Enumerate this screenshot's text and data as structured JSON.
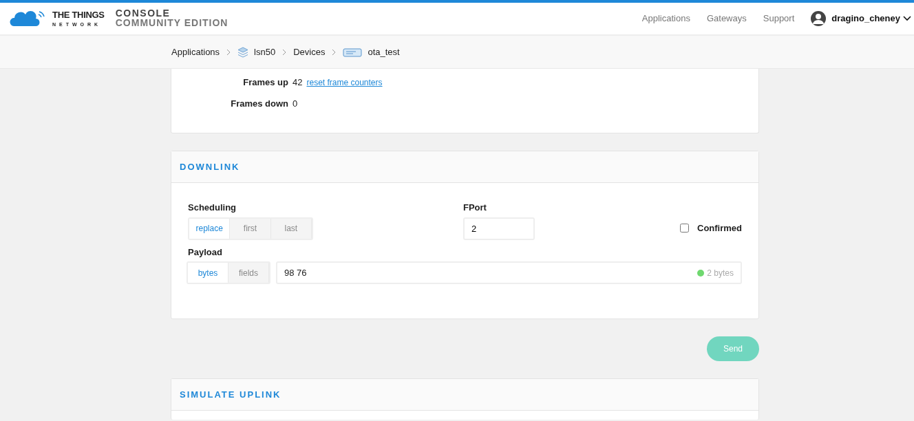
{
  "header": {
    "logo_name": "THE THINGS",
    "logo_sub": "NETWORK",
    "console_title": "CONSOLE",
    "console_edition": "COMMUNITY EDITION",
    "nav": [
      {
        "label": "Applications"
      },
      {
        "label": "Gateways"
      },
      {
        "label": "Support"
      }
    ],
    "user": "dragino_cheney"
  },
  "breadcrumb": [
    {
      "label": "Applications",
      "kind": "list"
    },
    {
      "label": "lsn50",
      "kind": "application"
    },
    {
      "label": "Devices",
      "kind": "list"
    },
    {
      "label": "ota_test",
      "kind": "device"
    }
  ],
  "counters": [
    {
      "label": "Frames up",
      "value": "42",
      "link": "reset frame counters"
    },
    {
      "label": "Frames down",
      "value": "0"
    }
  ],
  "downlink": {
    "title": "DOWNLINK",
    "scheduling_label": "Scheduling",
    "scheduling": [
      {
        "label": "replace",
        "selected": true
      },
      {
        "label": "first",
        "selected": false
      },
      {
        "label": "last",
        "selected": false
      }
    ],
    "fport_label": "FPort",
    "fport": "2",
    "confirmed_label": "Confirmed",
    "confirmed": false,
    "payload_label": "Payload",
    "payload_modes": [
      {
        "label": "bytes",
        "selected": true
      },
      {
        "label": "fields",
        "selected": false
      }
    ],
    "payload": "98 76",
    "payload_valid": true,
    "payload_size": "2 bytes"
  },
  "send_button": {
    "label": "Send",
    "disabled": true
  },
  "simulate_uplink": {
    "title": "SIMULATE UPLINK"
  }
}
